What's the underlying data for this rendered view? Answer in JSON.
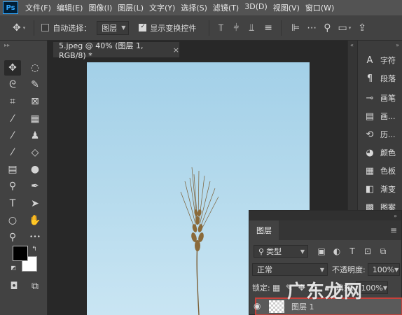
{
  "menubar": {
    "logo": "Ps",
    "items": [
      "文件(F)",
      "编辑(E)",
      "图像(I)",
      "图层(L)",
      "文字(Y)",
      "选择(S)",
      "滤镜(T)",
      "3D(D)",
      "视图(V)",
      "窗口(W)"
    ]
  },
  "options": {
    "auto_select_label": "自动选择：",
    "auto_select_target": "图层",
    "show_transform_label": "显示变换控件",
    "show_transform_checked": true,
    "auto_select_checked": false
  },
  "document": {
    "tab_title": "5.jpeg @ 40% (图层 1, RGB/8) *",
    "tab_close": "×",
    "zoom_percent": 40,
    "canvas_colors": {
      "sky_top": "#a3d0e8",
      "sky_bottom": "#c9e5f3",
      "wheat": "#8a6a3a"
    }
  },
  "tools": [
    {
      "name": "move-tool-icon",
      "glyph": "✥"
    },
    {
      "name": "ellipse-marquee-tool-icon",
      "glyph": "◌"
    },
    {
      "name": "lasso-tool-icon",
      "glyph": "ᘓ"
    },
    {
      "name": "quick-selection-tool-icon",
      "glyph": "✎"
    },
    {
      "name": "crop-tool-icon",
      "glyph": "⌗"
    },
    {
      "name": "frame-tool-icon",
      "glyph": "⊠"
    },
    {
      "name": "eyedropper-tool-icon",
      "glyph": "⁄"
    },
    {
      "name": "spot-healing-tool-icon",
      "glyph": "▦"
    },
    {
      "name": "brush-tool-icon",
      "glyph": "⁄"
    },
    {
      "name": "stamp-tool-icon",
      "glyph": "♟"
    },
    {
      "name": "history-brush-tool-icon",
      "glyph": "⁄"
    },
    {
      "name": "eraser-tool-icon",
      "glyph": "◇"
    },
    {
      "name": "gradient-tool-icon",
      "glyph": "▤"
    },
    {
      "name": "blur-tool-icon",
      "glyph": "●"
    },
    {
      "name": "dodge-tool-icon",
      "glyph": "⚲"
    },
    {
      "name": "pen-tool-icon",
      "glyph": "✒"
    },
    {
      "name": "type-tool-icon",
      "glyph": "T"
    },
    {
      "name": "path-selection-tool-icon",
      "glyph": "➤"
    },
    {
      "name": "ellipse-shape-tool-icon",
      "glyph": "○"
    },
    {
      "name": "hand-tool-icon",
      "glyph": "✋"
    },
    {
      "name": "zoom-tool-icon",
      "glyph": "⚲"
    },
    {
      "name": "more-tools-icon",
      "glyph": "•••"
    }
  ],
  "colors": {
    "foreground": "#000000",
    "background": "#ffffff"
  },
  "right_panel": {
    "items": [
      {
        "icon": "character-icon",
        "glyph": "A",
        "label": "字符"
      },
      {
        "icon": "paragraph-icon",
        "glyph": "¶",
        "label": "段落"
      },
      {
        "icon": "brush-settings-icon",
        "glyph": "⊸",
        "label": "画笔"
      },
      {
        "icon": "brushes-icon",
        "glyph": "▤",
        "label": "画..."
      },
      {
        "icon": "history-icon",
        "glyph": "⟲",
        "label": "历..."
      },
      {
        "icon": "color-icon",
        "glyph": "◕",
        "label": "颜色"
      },
      {
        "icon": "swatches-icon",
        "glyph": "▦",
        "label": "色板"
      },
      {
        "icon": "gradients-icon",
        "glyph": "◧",
        "label": "渐变"
      },
      {
        "icon": "patterns-icon",
        "glyph": "▩",
        "label": "图案"
      }
    ]
  },
  "layers": {
    "tab": "图层",
    "kind_filter": "类型",
    "blend_mode": "正常",
    "opacity_label": "不透明度:",
    "opacity_value": "100%",
    "lock_label": "锁定:",
    "fill_label": "填充:",
    "fill_value": "100%",
    "layer_name": "图层 1"
  },
  "watermark": "广东龙网"
}
